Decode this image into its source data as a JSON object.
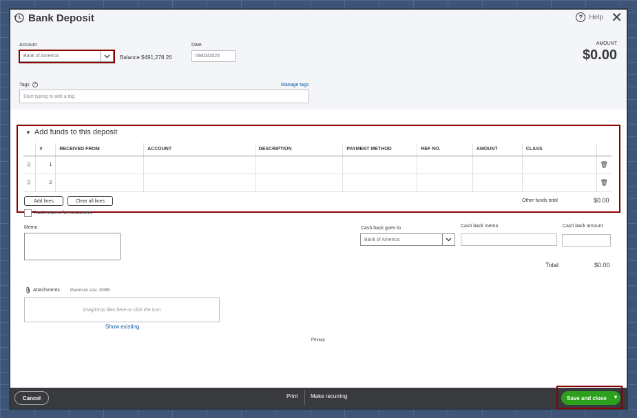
{
  "dialog": {
    "title": "Bank Deposit",
    "help_label": "Help",
    "help_glyph": "?",
    "close_glyph": "✕"
  },
  "header": {
    "account_label": "Account",
    "account_value": "Bank of America",
    "balance_text": "Balance $491,278.26",
    "date_label": "Date",
    "date_value": "09/03/2023",
    "amount_label": "AMOUNT",
    "amount_value": "$0.00",
    "tags_label": "Tags",
    "tags_help_glyph": "?",
    "manage_tags_link": "Manage tags",
    "tags_placeholder": "Start typing to add a tag"
  },
  "funds_section": {
    "toggle_glyph": "▼",
    "title": "Add funds to this deposit",
    "columns": [
      "#",
      "RECEIVED FROM",
      "ACCOUNT",
      "DESCRIPTION",
      "PAYMENT METHOD",
      "REF NO.",
      "AMOUNT",
      "CLASS"
    ],
    "rows": [
      {
        "num": "1",
        "grip": "⠿",
        "trash": "🗑"
      },
      {
        "num": "2",
        "grip": "⠿",
        "trash": "🗑"
      }
    ],
    "add_lines_label": "Add lines",
    "clear_lines_label": "Clear all lines",
    "other_total_label": "Other funds total",
    "other_total_value": "$0.00"
  },
  "lower": {
    "track_returns_label": "Track returns for customers",
    "memo_label": "Memo",
    "cash_back_goes_to_label": "Cash back goes to",
    "cash_back_goes_to_value": "Bank of America",
    "cash_back_memo_label": "Cash back memo",
    "cash_back_amount_label": "Cash back amount",
    "total_label": "Total",
    "total_value": "$0.00",
    "attachments_label": "Attachments",
    "max_size_text": "Maximum size: 20MB",
    "dropzone_text": "Drag/Drop files here or click the icon",
    "show_existing_link": "Show existing",
    "privacy_link": "Privacy"
  },
  "footer": {
    "cancel_label": "Cancel",
    "print_label": "Print",
    "make_recurring_label": "Make recurring",
    "save_close_label": "Save and close",
    "save_caret_glyph": "▾"
  },
  "colors": {
    "accent_green": "#2ca01c",
    "footer_bg": "#393a3d",
    "highlight_red": "#8b0000",
    "link_blue": "#0d5aa7"
  },
  "icons": [
    "history-icon",
    "help-icon",
    "close-icon",
    "chevron-down-icon",
    "drag-handle-icon",
    "trash-icon",
    "paperclip-icon",
    "caret-down-icon"
  ]
}
